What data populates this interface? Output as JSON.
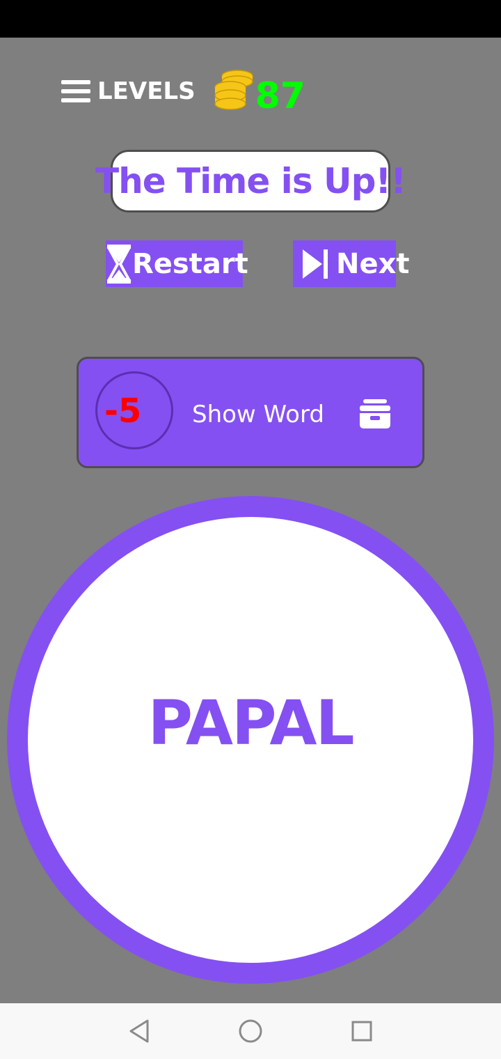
{
  "header": {
    "levels_label": "LEVELS",
    "coins": "87",
    "icons": {
      "menu": "hamburger-menu-icon",
      "coins": "coin-stack-icon"
    }
  },
  "banner": {
    "text": "The Time is Up!!"
  },
  "actions": {
    "restart_label": "Restart",
    "next_label": "Next",
    "icons": {
      "restart": "hourglass-icon",
      "next": "skip-next-icon"
    }
  },
  "hint": {
    "cost": "-5",
    "label": "Show Word",
    "icon": "archive-box-icon"
  },
  "word": {
    "text": "PAPAL"
  },
  "nav": {
    "icons": [
      "back-triangle-icon",
      "home-circle-icon",
      "recents-square-icon"
    ]
  },
  "colors": {
    "background": "#7f7f7f",
    "accent_purple": "#8450f2",
    "coin_count_green": "#00ff00",
    "cost_red": "#ff0000",
    "coin_gold": "#f5c518"
  }
}
